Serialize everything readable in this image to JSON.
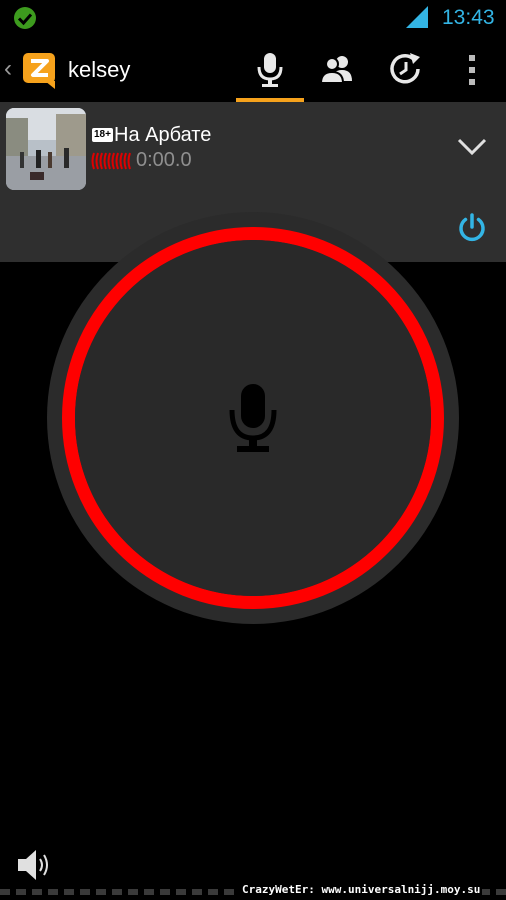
{
  "status_bar": {
    "time": "13:43",
    "notification_icon": "check-circle-icon",
    "signal_icon": "signal-icon"
  },
  "action_bar": {
    "user_name": "kelsey",
    "tabs": [
      {
        "name": "talk",
        "icon": "microphone-icon",
        "selected": true
      },
      {
        "name": "contacts",
        "icon": "contacts-icon",
        "selected": false
      },
      {
        "name": "history",
        "icon": "history-icon",
        "selected": false
      }
    ],
    "overflow_icon": "overflow-menu-icon"
  },
  "channel": {
    "age_badge": "18+",
    "name": "На Арбате",
    "timer": "0:00.0",
    "expand_icon": "chevron-down-icon",
    "power_icon": "power-icon"
  },
  "talk_button": {
    "icon": "microphone-icon",
    "ring_color": "#ff0000"
  },
  "footer": {
    "speaker_icon": "speaker-icon",
    "watermark": "CrazyWetEr: www.universalnijj.moy.su"
  },
  "colors": {
    "accent": "#f6a21c",
    "clock": "#33b5e5",
    "power": "#33b5e5",
    "ring": "#ff0000"
  }
}
